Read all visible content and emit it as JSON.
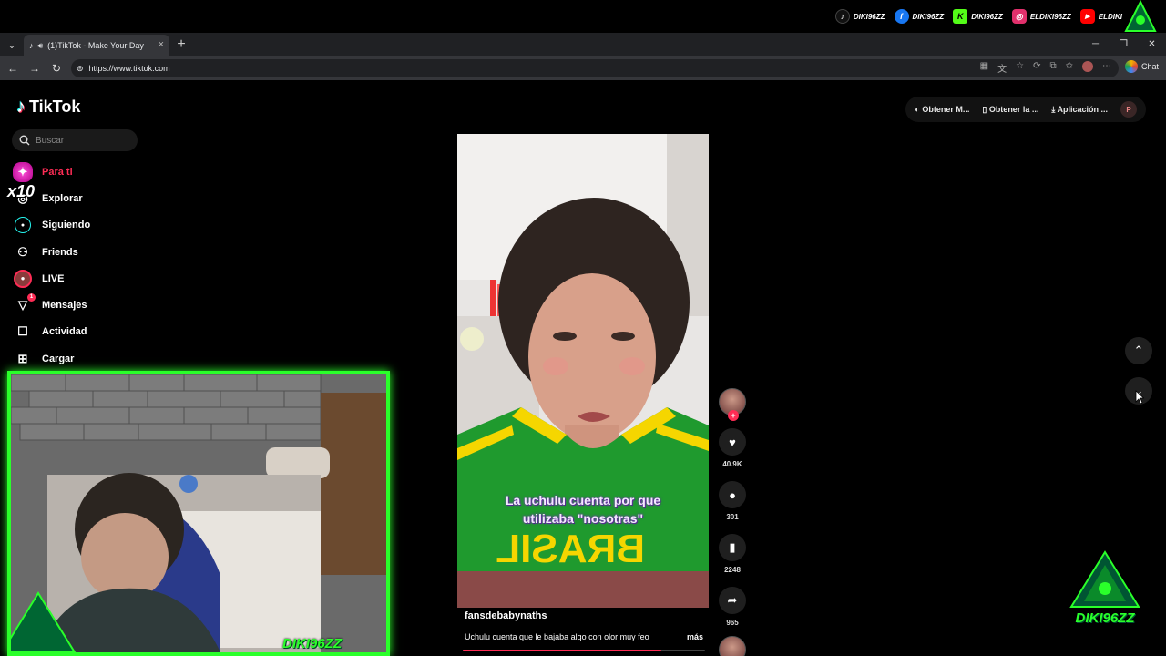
{
  "overlay": {
    "socials": [
      {
        "icon": "tiktok-icon",
        "label": "DIKI96ZZ",
        "color": "#ffffff"
      },
      {
        "icon": "facebook-icon",
        "label": "DIKI96ZZ",
        "color": "#1877f2"
      },
      {
        "icon": "kick-icon",
        "label": "DIKI96ZZ",
        "color": "#53fc18"
      },
      {
        "icon": "instagram-icon",
        "label": "ELDIKI96ZZ",
        "color": "#e1306c"
      },
      {
        "icon": "youtube-icon",
        "label": "ELDIKI",
        "color": "#ff0000"
      }
    ],
    "cam_tag": "DIKI96ZZ",
    "corner_logo_text": "DIKI96ZZ",
    "multiplier": "x10",
    "accent": "#2aff2a"
  },
  "browser": {
    "tab_title": "(1)TikTok - Make Your Day",
    "url": "https://www.tiktok.com",
    "chat_label": "Chat"
  },
  "tiktok": {
    "brand": "TikTok",
    "search_placeholder": "Buscar",
    "nav": [
      {
        "label": "Para ti",
        "icon": "home-icon",
        "active": true
      },
      {
        "label": "Explorar",
        "icon": "compass-icon"
      },
      {
        "label": "Siguiendo",
        "icon": "following-icon"
      },
      {
        "label": "Friends",
        "icon": "friends-icon"
      },
      {
        "label": "LIVE",
        "icon": "live-icon"
      },
      {
        "label": "Mensajes",
        "icon": "messages-icon",
        "badge": "1"
      },
      {
        "label": "Actividad",
        "icon": "activity-icon"
      },
      {
        "label": "Cargar",
        "icon": "upload-icon"
      }
    ],
    "top_actions": {
      "effects": "Obtener M...",
      "app": "Obtener la ...",
      "desktop": "Aplicación ...",
      "avatar_initial": "P"
    },
    "video": {
      "caption_line1": "La uchulu cuenta por que",
      "caption_line2": "utilizaba \"nosotras\"",
      "author": "fansdebabynaths",
      "description": "Uchulu cuenta que le bajaba algo con olor muy feo",
      "more": "más",
      "progress": 0.82
    },
    "stats": {
      "likes": "40.9K",
      "comments": "301",
      "saves": "2248",
      "shares": "965"
    }
  }
}
